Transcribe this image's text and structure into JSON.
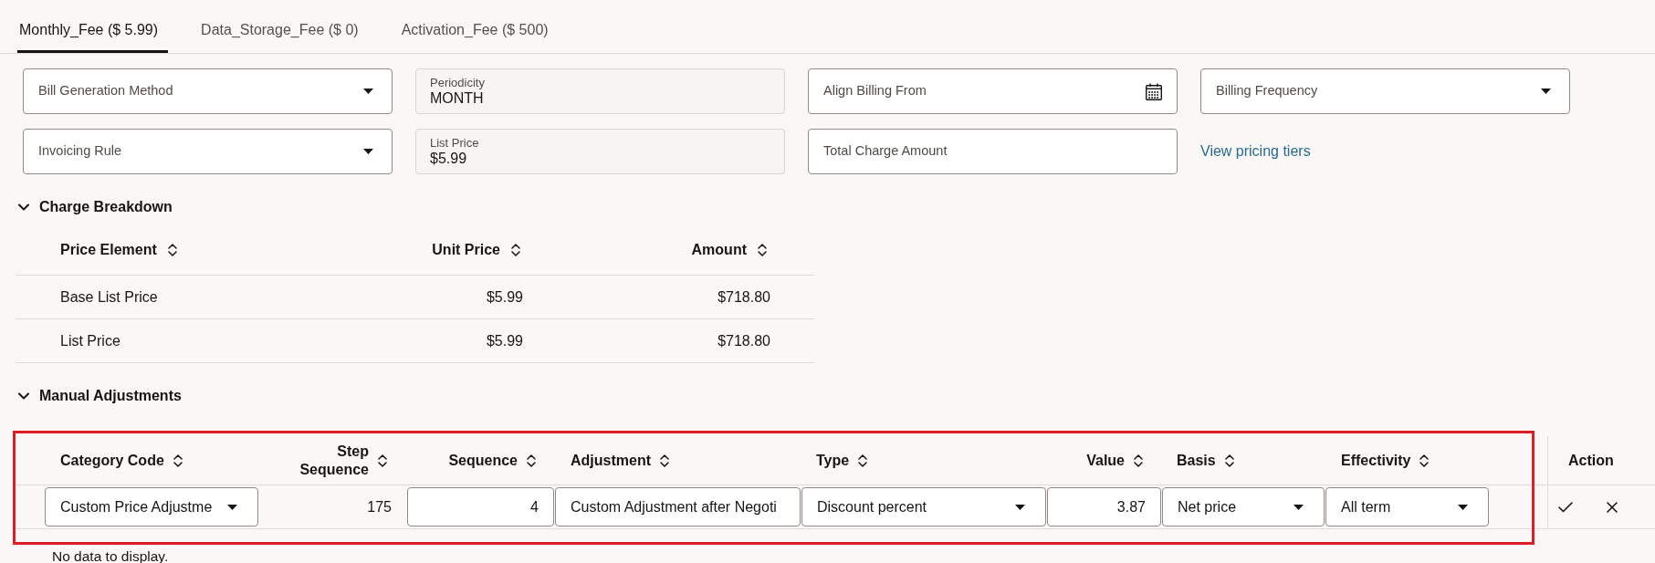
{
  "tabs": [
    {
      "label": "Monthly_Fee ($ 5.99)",
      "selected": true
    },
    {
      "label": "Data_Storage_Fee ($ 0)",
      "selected": false
    },
    {
      "label": "Activation_Fee ($ 500)",
      "selected": false
    }
  ],
  "fields": [
    {
      "kind": "select",
      "label": "Bill Generation Method"
    },
    {
      "kind": "readonly",
      "label": "Periodicity",
      "value": "MONTH"
    },
    {
      "kind": "date",
      "label": "Align Billing From"
    },
    {
      "kind": "select",
      "label": "Billing Frequency"
    },
    {
      "kind": "select",
      "label": "Invoicing Rule"
    },
    {
      "kind": "readonly",
      "label": "List Price",
      "value": "$5.99"
    },
    {
      "kind": "text",
      "label": "Total Charge Amount"
    },
    {
      "kind": "link",
      "label": "View pricing tiers"
    }
  ],
  "charge_breakdown": {
    "title": "Charge Breakdown",
    "expanded": true,
    "columns": [
      {
        "label": "Price Element",
        "sortable": true
      },
      {
        "label": "Unit Price",
        "sortable": true
      },
      {
        "label": "Amount",
        "sortable": true
      }
    ],
    "rows": [
      [
        "Base List Price",
        "$5.99",
        "$718.80"
      ],
      [
        "List Price",
        "$5.99",
        "$718.80"
      ]
    ]
  },
  "manual_adjustments": {
    "title": "Manual Adjustments",
    "expanded": true,
    "highlighted": true,
    "columns": [
      {
        "label": "Category Code",
        "sortable": true
      },
      {
        "label": "Step Sequence",
        "sortable": true
      },
      {
        "label": "Sequence",
        "sortable": true
      },
      {
        "label": "Adjustment",
        "sortable": true
      },
      {
        "label": "Type",
        "sortable": true
      },
      {
        "label": "Value",
        "sortable": true
      },
      {
        "label": "Basis",
        "sortable": true
      },
      {
        "label": "Effectivity",
        "sortable": true
      },
      {
        "label": "Action",
        "sortable": false
      }
    ],
    "rows": [
      {
        "cells": [
          {
            "kind": "select",
            "value": "Custom Price Adjustme"
          },
          {
            "kind": "text",
            "value": "175"
          },
          {
            "kind": "input",
            "value": "4"
          },
          {
            "kind": "input",
            "value": "Custom Adjustment after Negoti"
          },
          {
            "kind": "select",
            "value": "Discount percent"
          },
          {
            "kind": "input",
            "value": "3.87"
          },
          {
            "kind": "select",
            "value": "Net price"
          },
          {
            "kind": "select",
            "value": "All term"
          }
        ]
      }
    ],
    "empty_message": "No data to display."
  }
}
